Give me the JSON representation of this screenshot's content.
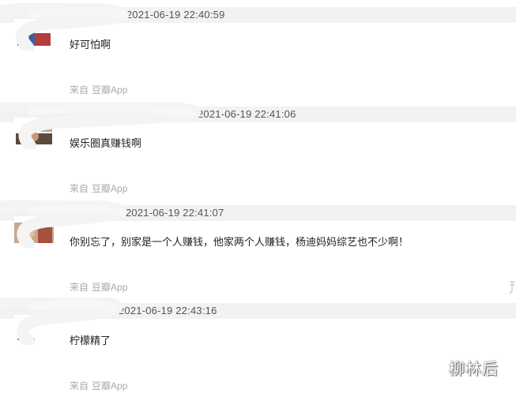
{
  "comments": [
    {
      "time": "2021-06-19 22:40:59",
      "text": "好可怕啊",
      "source_prefix": "来自",
      "source_app": "豆瓣App"
    },
    {
      "time": "2021-06-19 22:41:06",
      "text": "娱乐圈真赚钱啊",
      "source_prefix": "来自",
      "source_app": "豆瓣App"
    },
    {
      "time": "2021-06-19 22:41:07",
      "text": "你别忘了，别家是一个人赚钱，他家两个人赚钱，杨迪妈妈综艺也不少啊！",
      "source_prefix": "来自",
      "source_app": "豆瓣App"
    },
    {
      "time": "2021-06-19 22:43:16",
      "text": "柠檬精了",
      "source_prefix": "来自",
      "source_app": "豆瓣App"
    }
  ],
  "watermark": "柳林后",
  "colors": {
    "header_bar": "#f0f3ef",
    "source_text": "#a9a9a9",
    "timestamp_text": "#555555",
    "body_text": "#222222"
  }
}
